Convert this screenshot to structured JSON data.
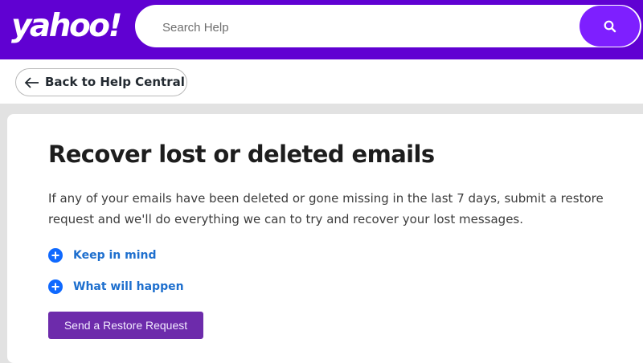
{
  "header": {
    "logo_text": "yahoo!",
    "brand_color": "#6001d2",
    "search": {
      "placeholder": "Search Help",
      "button_icon": "search-icon",
      "button_color": "#7e1fff"
    }
  },
  "nav": {
    "back_label": "Back to Help Central",
    "back_icon": "arrow-left-icon"
  },
  "article": {
    "title": "Recover lost or deleted emails",
    "description": "If any of your emails have been deleted or gone missing in the last 7 days, submit a restore request and we'll do everything we can to try and recover your lost messages.",
    "expanders": [
      {
        "label": "Keep in mind",
        "icon": "plus-circle-icon"
      },
      {
        "label": "What will happen",
        "icon": "plus-circle-icon"
      }
    ],
    "action_button_label": "Send a Restore Request",
    "accent_color": "#6d2bab",
    "link_color": "#1e6fce"
  }
}
